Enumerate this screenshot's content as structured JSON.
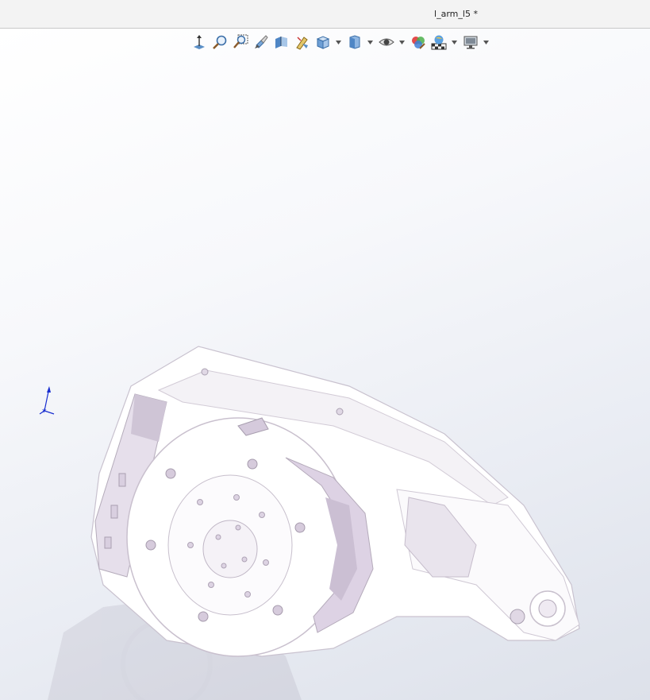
{
  "window": {
    "title": "l_arm_l5 *"
  },
  "toolbar": {
    "buttons": [
      {
        "icon": "view-normal-to-icon",
        "has_dropdown": false
      },
      {
        "icon": "zoom-to-fit-icon",
        "has_dropdown": false
      },
      {
        "icon": "zoom-to-area-icon",
        "has_dropdown": false
      },
      {
        "icon": "previous-view-icon",
        "has_dropdown": false
      },
      {
        "icon": "section-view-icon",
        "has_dropdown": false
      },
      {
        "icon": "dynamic-annotation-icon",
        "has_dropdown": false
      },
      {
        "icon": "view-orientation-icon",
        "has_dropdown": true
      },
      {
        "icon": "display-style-icon",
        "has_dropdown": true
      },
      {
        "icon": "hide-show-items-icon",
        "has_dropdown": true
      },
      {
        "icon": "edit-appearance-icon",
        "has_dropdown": false
      },
      {
        "icon": "apply-scene-icon",
        "has_dropdown": true
      },
      {
        "icon": "view-settings-icon",
        "has_dropdown": true
      }
    ]
  },
  "colors": {
    "accent_blue": "#1f6fc5",
    "triad_blue": "#1a2fd0",
    "model_shade": "#d9cfe0",
    "model_edge": "#8a8090"
  }
}
